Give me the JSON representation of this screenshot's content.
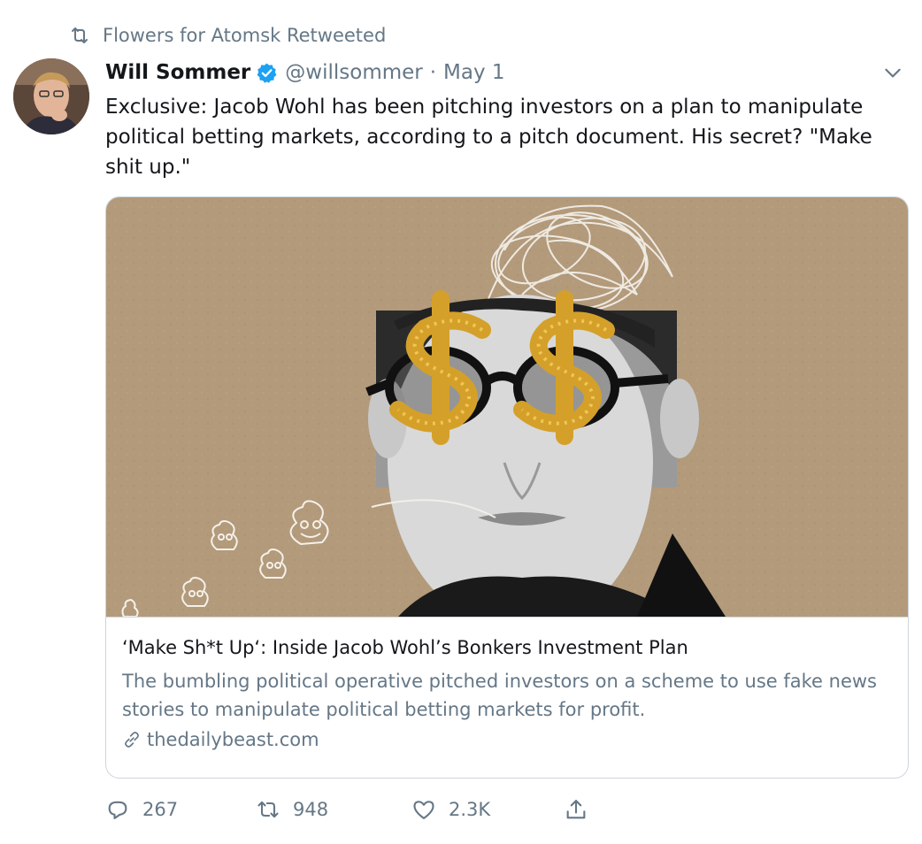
{
  "retweet_context": {
    "text": "Flowers for Atomsk Retweeted",
    "icon": "retweet-icon"
  },
  "author": {
    "name": "Will Sommer",
    "verified": true,
    "handle": "@willsommer",
    "separator": "·",
    "date": "May 1"
  },
  "tweet": {
    "text": "Exclusive: Jacob Wohl has been pitching investors on a plan to manipulate political betting markets, according to a pitch document. His secret? \"Make shit up.\""
  },
  "card": {
    "title": "‘Make Sh*t Up‘: Inside Jacob Wohl’s Bonkers Investment Plan",
    "description": "The bumbling political operative pitched investors on a scheme to use fake news stories to manipulate political betting markets for profit.",
    "domain": "thedailybeast.com"
  },
  "actions": {
    "replies": "267",
    "retweets": "948",
    "likes": "2.3K"
  },
  "colors": {
    "accent": "#1da1f2",
    "secondary_text": "#657786",
    "border": "#ccd6dd",
    "card_background": "#b39a7b",
    "glitter_gold": "#d4a02a"
  }
}
